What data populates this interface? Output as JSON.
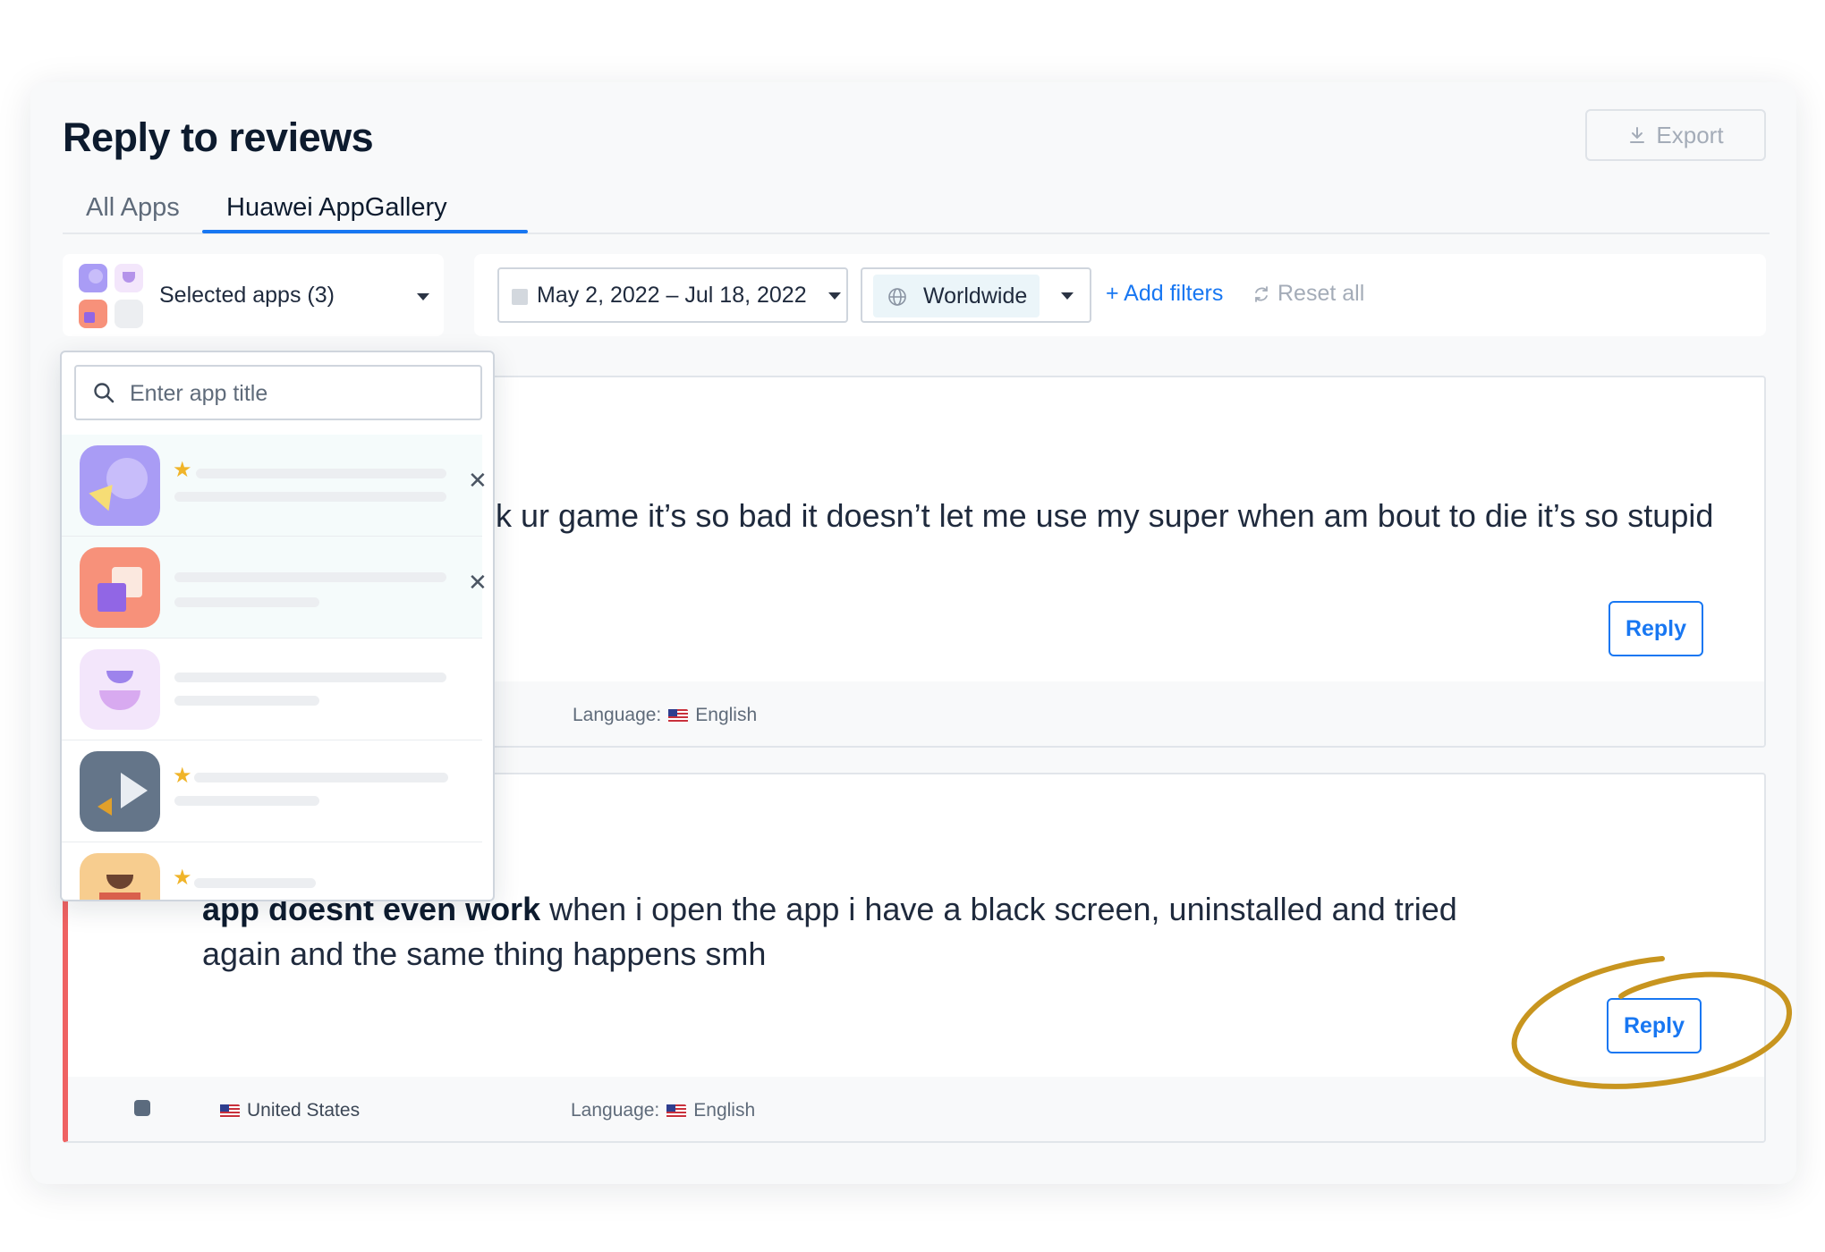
{
  "page": {
    "title": "Reply to reviews",
    "export_label": "Export"
  },
  "tabs": [
    {
      "label": "All Apps",
      "active": false
    },
    {
      "label": "Huawei AppGallery",
      "active": true
    }
  ],
  "app_selector": {
    "label": "Selected apps (3)"
  },
  "filters": {
    "date_range": "May 2, 2022 – Jul 18, 2022",
    "region": "Worldwide",
    "add_filters": "+ Add filters",
    "reset_all": "Reset all"
  },
  "app_dropdown": {
    "search_placeholder": "Enter app title",
    "apps": [
      {
        "icon": "purple-app-icon",
        "favorite": true,
        "selected": true
      },
      {
        "icon": "coral-app-icon",
        "favorite": false,
        "selected": true
      },
      {
        "icon": "lilac-app-icon",
        "favorite": false,
        "selected": false
      },
      {
        "icon": "slate-app-icon",
        "favorite": true,
        "selected": false
      },
      {
        "icon": "sand-app-icon",
        "favorite": true,
        "selected": false
      }
    ]
  },
  "reviews": [
    {
      "text": "k ur game it’s so bad it doesn’t let me use my super when am bout to die it’s so stupid",
      "reply_label": "Reply",
      "language_label": "Language:",
      "language": "English"
    },
    {
      "title": "app doesnt even work",
      "text": " when i open the app i have a black screen, uninstalled and tried again and the same thing happens smh",
      "reply_label": "Reply",
      "country": "United States",
      "language_label": "Language:",
      "language": "English"
    }
  ],
  "colors": {
    "accent": "#1877f2",
    "annotation": "#c8951f",
    "negative_review": "#ef6262"
  }
}
